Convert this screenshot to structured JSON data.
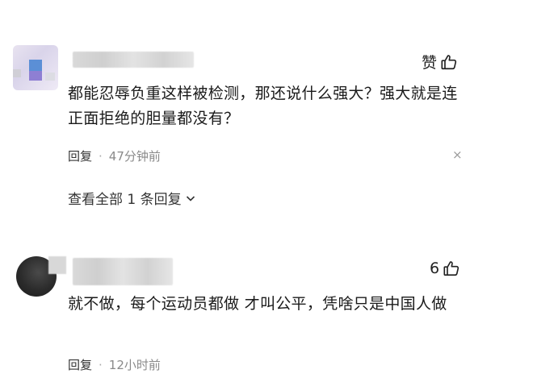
{
  "comments": [
    {
      "like_label": "赞",
      "text": "都能忍辱负重这样被检测，那还说什么强大？强大就是连正面拒绝的胆量都没有？",
      "reply_label": "回复",
      "separator": "·",
      "time": "47分钟前",
      "close_glyph": "×",
      "view_all": "查看全部 1 条回复"
    },
    {
      "like_count": "6",
      "text": "就不做，每个运动员都做 才叫公平，凭啥只是中国人做",
      "reply_label": "回复",
      "separator": "·",
      "time": "12小时前"
    }
  ],
  "icons": {
    "like": "thumbs-up-icon",
    "expand": "chevron-down-icon",
    "close": "close-icon"
  },
  "colors": {
    "text": "#1a1a1a",
    "meta": "#8a8a8a",
    "avatar1_blue": "#5b8fd6",
    "avatar1_purple": "#8e7fd3",
    "avatar2_dark": "#2b2b2b"
  }
}
